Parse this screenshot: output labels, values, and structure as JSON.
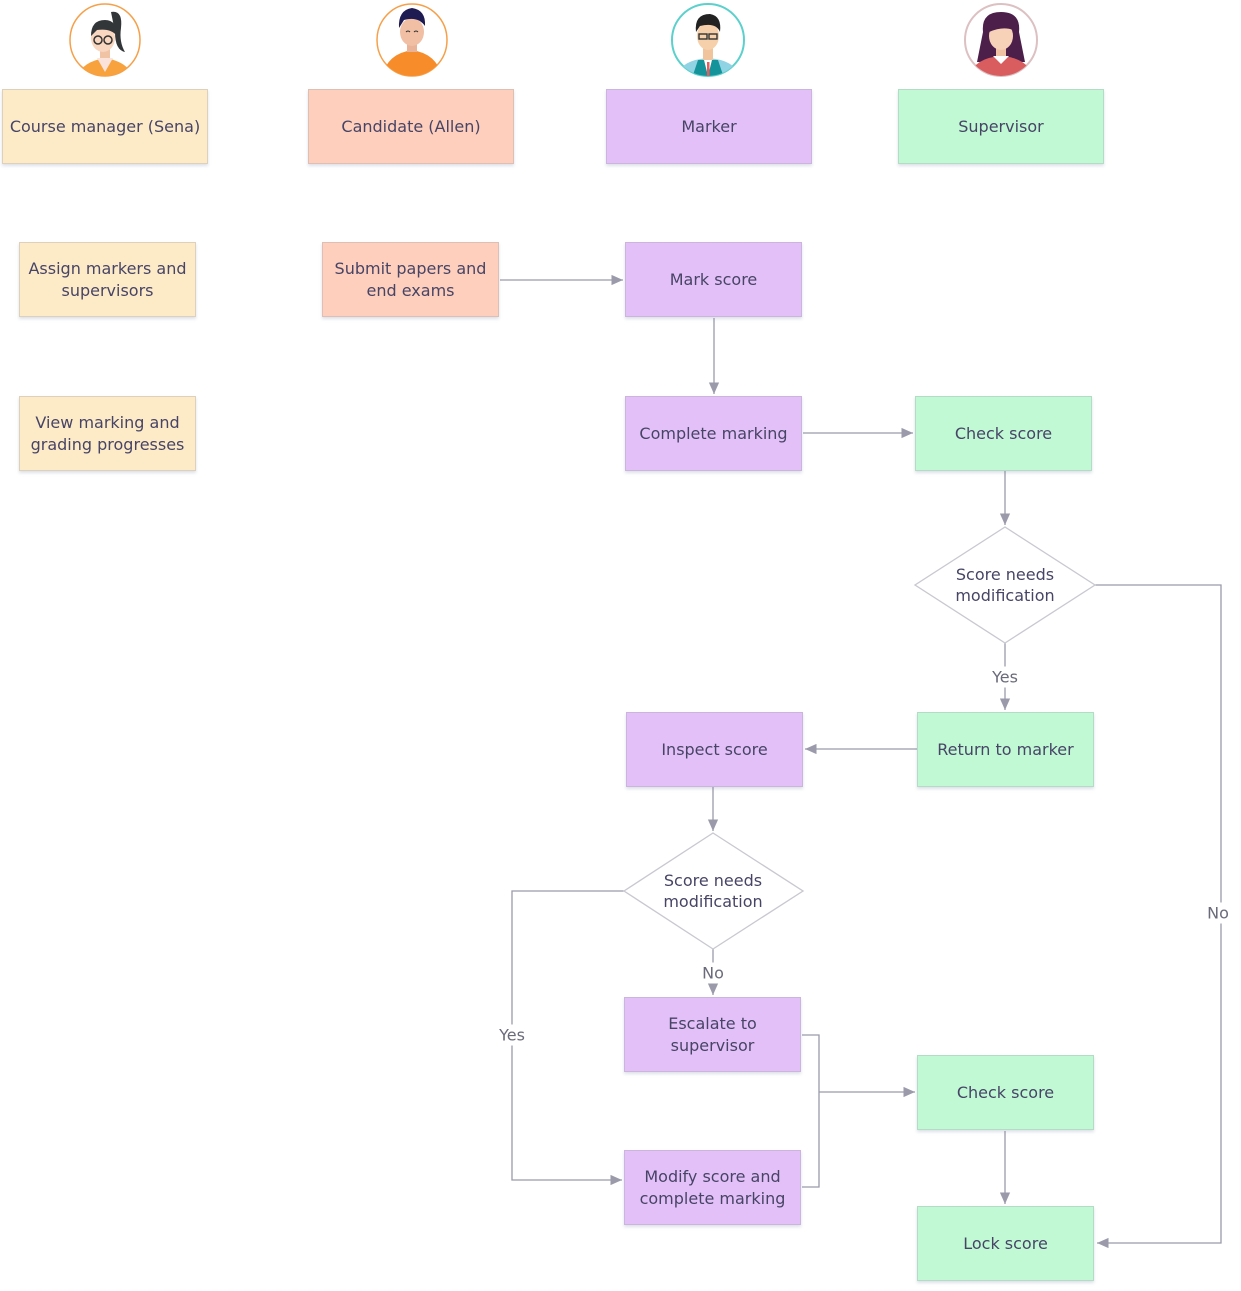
{
  "lanes": [
    {
      "label": "Course manager (Sena)",
      "avatar": "woman-glasses-avatar",
      "color": "#fdebc8"
    },
    {
      "label": "Candidate (Allen)",
      "avatar": "man-orange-shirt-avatar",
      "color": "#fdcfbc"
    },
    {
      "label": "Marker",
      "avatar": "man-glasses-tie-avatar",
      "color": "#e3c1f8"
    },
    {
      "label": "Supervisor",
      "avatar": "woman-red-top-avatar",
      "color": "#c1f9d5"
    }
  ],
  "nodes": {
    "assign": "Assign markers and supervisors",
    "view": "View marking and grading progresses",
    "submit": "Submit papers and end exams",
    "mark": "Mark score",
    "complete": "Complete marking",
    "check1": "Check score",
    "decision1": "Score needs modification",
    "return": "Return to marker",
    "inspect": "Inspect score",
    "decision2": "Score needs modification",
    "escalate": "Escalate to supervisor",
    "modify": "Modify score and complete marking",
    "check2": "Check score",
    "lock": "Lock score"
  },
  "edge_labels": {
    "d1_yes": "Yes",
    "d1_no": "No",
    "d2_no": "No",
    "d2_yes": "Yes"
  },
  "colors": {
    "line": "#9a9aaa",
    "text": "#474466"
  }
}
